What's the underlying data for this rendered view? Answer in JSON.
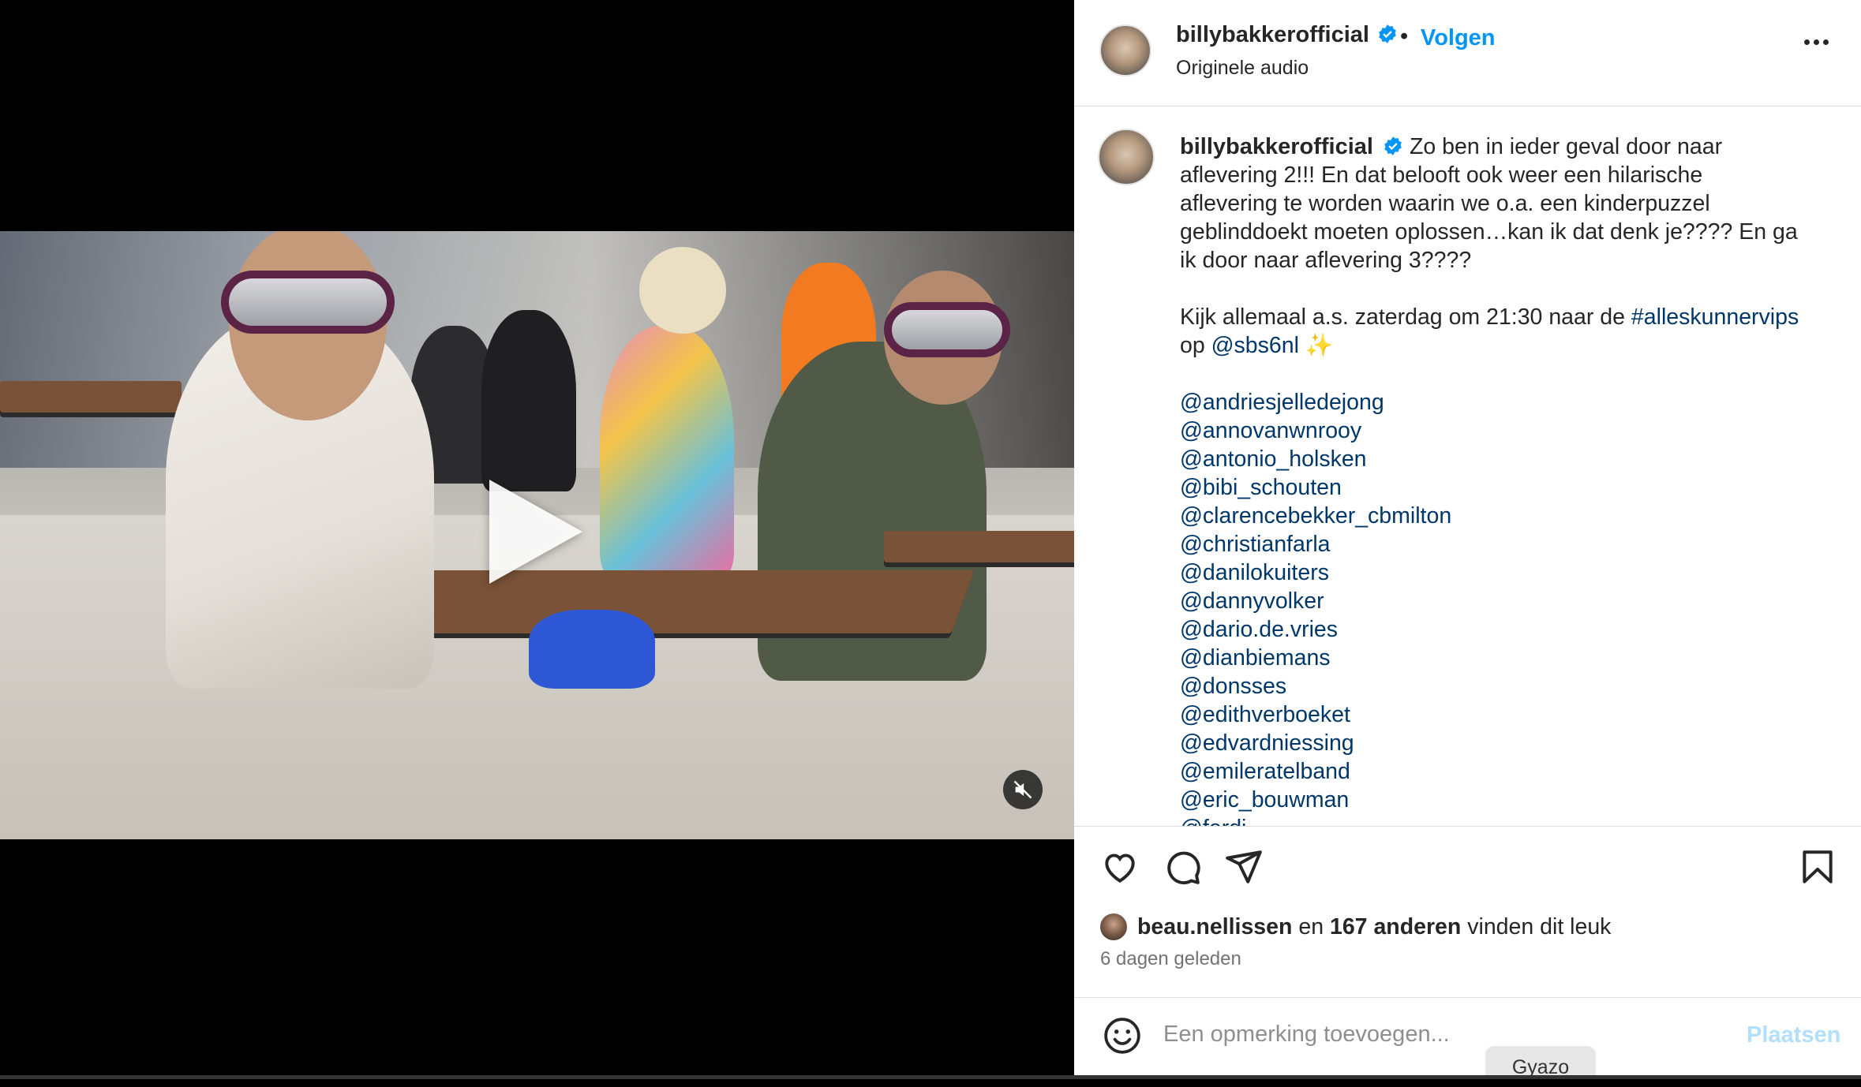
{
  "post": {
    "username": "billybakkerofficial",
    "dot": "•",
    "follow_label": "Volgen",
    "audio": "Originele audio"
  },
  "caption": {
    "username": "billybakkerofficial",
    "text_lines": [
      "Zo ben in ieder geval door naar",
      "aflevering 2!!! En dat belooft ook weer een hilarische",
      "aflevering te worden waarin we o.a. een kinderpuzzel",
      "geblinddoekt moeten oplossen…kan ik dat denk je???? En ga",
      "ik door naar aflevering 3????"
    ],
    "line2_prefix": "Kijk allemaal a.s. zaterdag om 21:30 naar de ",
    "hashtag": "#alleskunnervips",
    "line3_prefix": "op ",
    "mention_sbs": "@sbs6nl",
    "sparkle": "✨",
    "mentions": [
      "@andriesjelledejong",
      "@annovanwnrooy",
      "@antonio_holsken",
      "@bibi_schouten",
      "@clarencebekker_cbmilton",
      "@christianfarla",
      "@danilokuiters",
      "@dannyvolker",
      "@dario.de.vries",
      "@dianbiemans",
      "@donsses",
      "@edithverboeket",
      "@edvardniessing",
      "@emileratelband",
      "@eric_bouwman",
      "@ferdi…"
    ]
  },
  "actions": {
    "icons": [
      "heart-icon",
      "comment-icon",
      "share-icon",
      "bookmark-icon"
    ]
  },
  "likes": {
    "first_user": "beau.nellissen",
    "connector": " en ",
    "others": "167 anderen",
    "suffix": " vinden dit leuk"
  },
  "timestamp": "6 dagen geleden",
  "comment": {
    "placeholder": "Een opmerking toevoegen...",
    "post_label": "Plaatsen"
  },
  "overlay": {
    "gyazo_label": "Gyazo"
  },
  "colors": {
    "link_blue": "#0095f6",
    "mention_navy": "#00376b",
    "text": "#262626",
    "muted": "#737373",
    "verified_blue": "#0095f6"
  }
}
